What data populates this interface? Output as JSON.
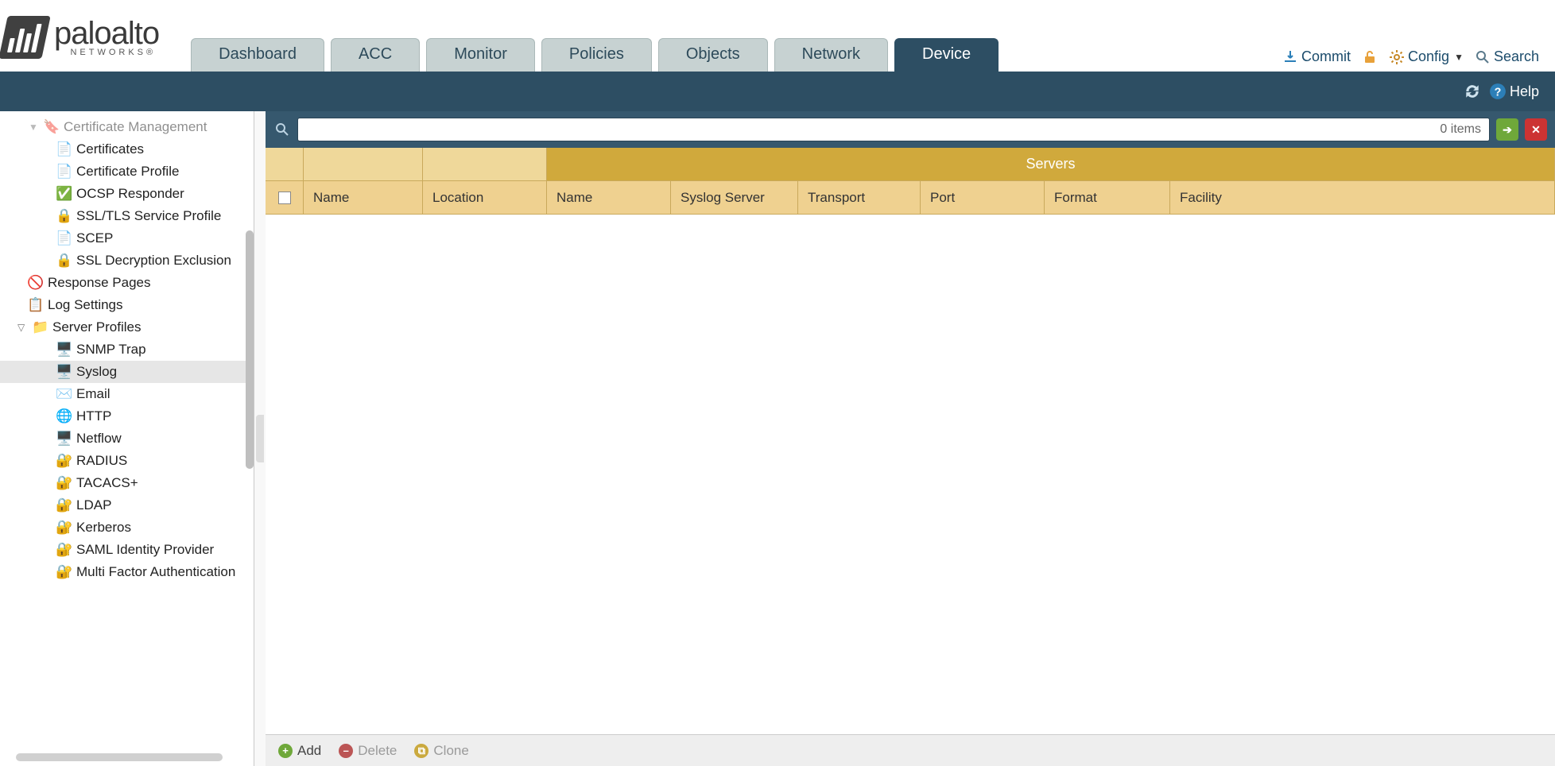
{
  "brand": {
    "name": "paloalto",
    "sub": "NETWORKS®"
  },
  "tabs": {
    "items": [
      "Dashboard",
      "ACC",
      "Monitor",
      "Policies",
      "Objects",
      "Network",
      "Device"
    ],
    "active": "Device"
  },
  "header_actions": {
    "commit": "Commit",
    "config": "Config",
    "search": "Search"
  },
  "subbar": {
    "help": "Help"
  },
  "filter": {
    "placeholder": "",
    "count_text": "0 items"
  },
  "sidebar": {
    "cert_mgmt": "Certificate Management",
    "certificates": "Certificates",
    "cert_profile": "Certificate Profile",
    "ocsp": "OCSP Responder",
    "ssl_tls": "SSL/TLS Service Profile",
    "scep": "SCEP",
    "ssl_decrypt_excl": "SSL Decryption Exclusion",
    "response_pages": "Response Pages",
    "log_settings": "Log Settings",
    "server_profiles": "Server Profiles",
    "snmp": "SNMP Trap",
    "syslog": "Syslog",
    "email": "Email",
    "http": "HTTP",
    "netflow": "Netflow",
    "radius": "RADIUS",
    "tacacs": "TACACS+",
    "ldap": "LDAP",
    "kerberos": "Kerberos",
    "saml": "SAML Identity Provider",
    "mfa": "Multi Factor Authentication"
  },
  "grid": {
    "servers_group": "Servers",
    "cols": {
      "name": "Name",
      "location": "Location",
      "sname": "Name",
      "syslog_server": "Syslog Server",
      "transport": "Transport",
      "port": "Port",
      "format": "Format",
      "facility": "Facility"
    }
  },
  "toolbar": {
    "add": "Add",
    "delete": "Delete",
    "clone": "Clone"
  }
}
